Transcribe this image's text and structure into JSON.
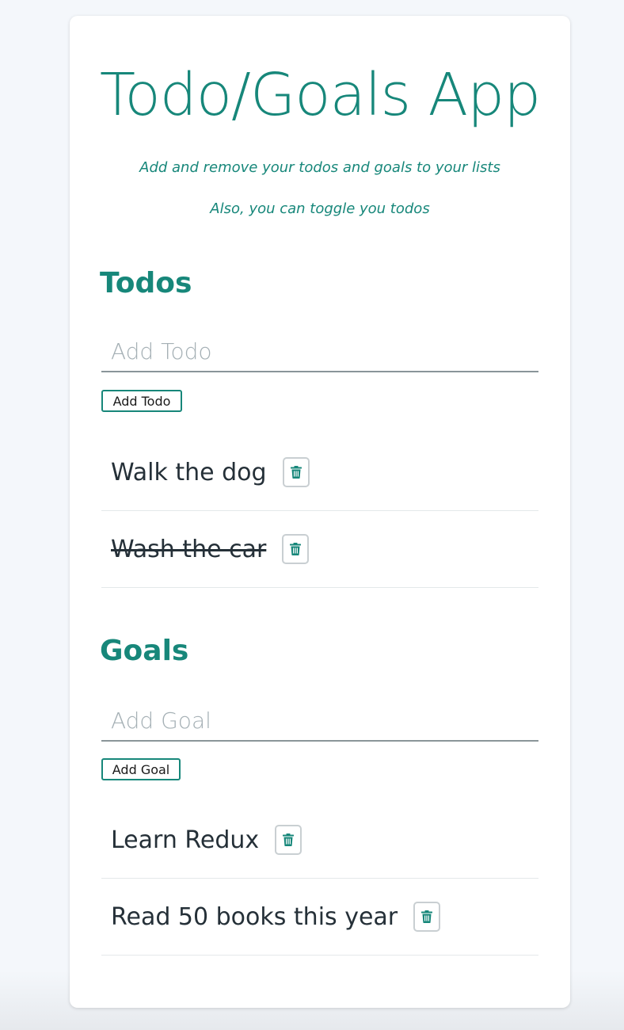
{
  "app": {
    "title": "Todo/Goals App",
    "subtitle_1": "Add and remove your todos and goals to your lists",
    "subtitle_2": "Also, you can toggle you todos",
    "accent_color": "#17877a"
  },
  "todos": {
    "heading": "Todos",
    "input_placeholder": "Add Todo",
    "input_value": "",
    "add_button_label": "Add Todo",
    "items": [
      {
        "text": "Walk the dog",
        "complete": false,
        "delete_icon": "trash-icon"
      },
      {
        "text": "Wash the car",
        "complete": true,
        "delete_icon": "trash-icon"
      }
    ]
  },
  "goals": {
    "heading": "Goals",
    "input_placeholder": "Add Goal",
    "input_value": "",
    "add_button_label": "Add Goal",
    "items": [
      {
        "text": "Learn Redux",
        "delete_icon": "trash-icon"
      },
      {
        "text": "Read 50 books this year",
        "delete_icon": "trash-icon"
      }
    ]
  }
}
